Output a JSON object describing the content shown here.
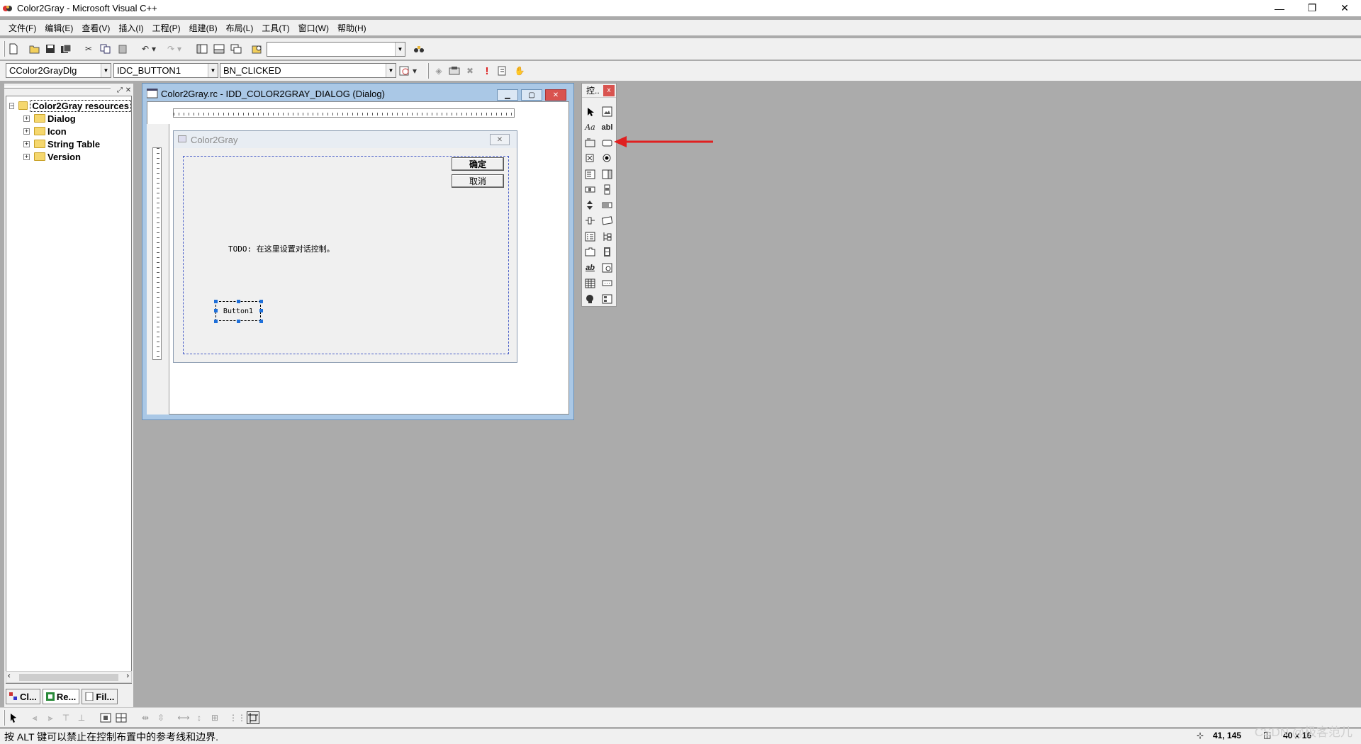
{
  "window": {
    "title": "Color2Gray - Microsoft Visual C++"
  },
  "title_buttons": {
    "minimize": "—",
    "restore": "❐",
    "close": "✕"
  },
  "menu": [
    "文件(F)",
    "编辑(E)",
    "查看(V)",
    "插入(I)",
    "工程(P)",
    "组建(B)",
    "布局(L)",
    "工具(T)",
    "窗口(W)",
    "帮助(H)"
  ],
  "wizardbar": {
    "class_combo": "CColor2GrayDlg",
    "id_combo": "IDC_BUTTON1",
    "msg_combo": "BN_CLICKED",
    "find_combo": ""
  },
  "workspace": {
    "root": "Color2Gray resources",
    "items": [
      "Dialog",
      "Icon",
      "String Table",
      "Version"
    ],
    "tabs": [
      "Cl...",
      "Re...",
      "Fil..."
    ]
  },
  "editor": {
    "caption": "Color2Gray.rc - IDD_COLOR2GRAY_DIALOG (Dialog)"
  },
  "dialog": {
    "caption": "Color2Gray",
    "ok_label": "确定",
    "cancel_label": "取消",
    "todo_text": "TODO: 在这里设置对话控制。",
    "button1_label": "Button1"
  },
  "palette": {
    "title": "控..",
    "close": "x"
  },
  "status": {
    "text": "按 ALT 键可以禁止在控制布置中的参考线和边界.",
    "position": "41, 145",
    "size": "40 x 16"
  },
  "watermark": "CSDN @极客范儿"
}
